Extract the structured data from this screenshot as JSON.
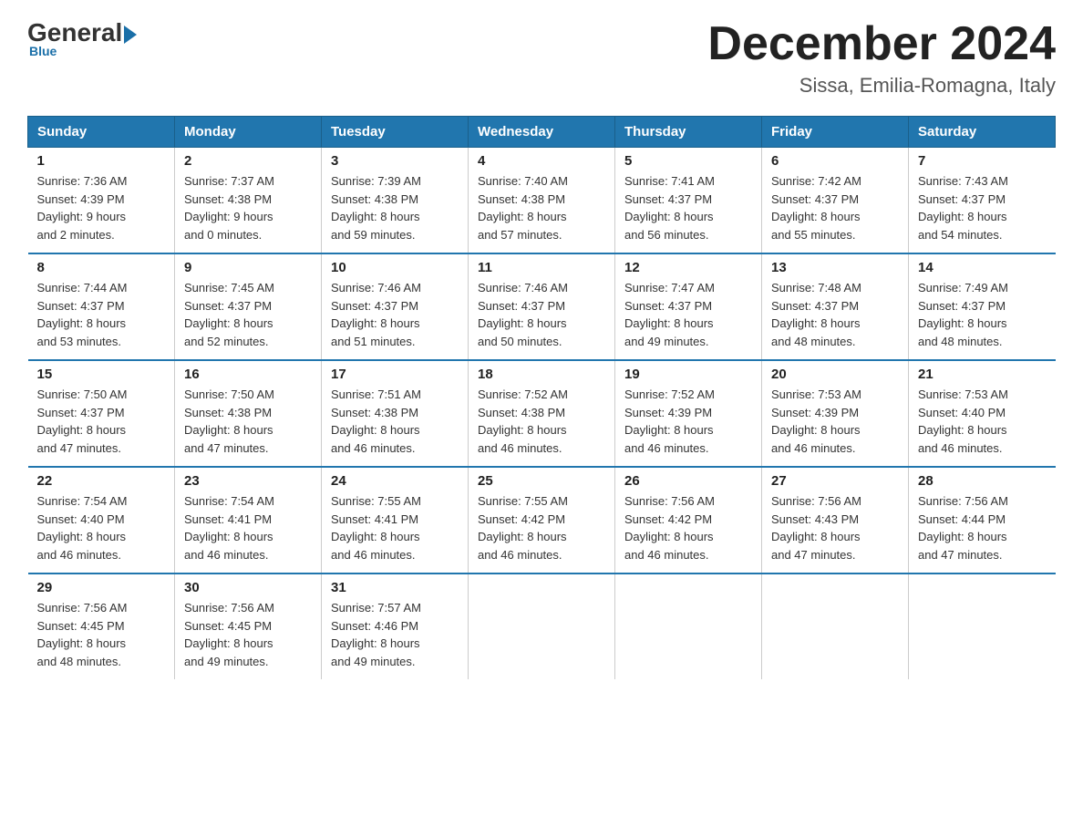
{
  "header": {
    "logo_general": "General",
    "logo_blue": "Blue",
    "month_title": "December 2024",
    "location": "Sissa, Emilia-Romagna, Italy"
  },
  "weekdays": [
    "Sunday",
    "Monday",
    "Tuesday",
    "Wednesday",
    "Thursday",
    "Friday",
    "Saturday"
  ],
  "weeks": [
    [
      {
        "day": "1",
        "sunrise": "7:36 AM",
        "sunset": "4:39 PM",
        "daylight": "9 hours and 2 minutes."
      },
      {
        "day": "2",
        "sunrise": "7:37 AM",
        "sunset": "4:38 PM",
        "daylight": "9 hours and 0 minutes."
      },
      {
        "day": "3",
        "sunrise": "7:39 AM",
        "sunset": "4:38 PM",
        "daylight": "8 hours and 59 minutes."
      },
      {
        "day": "4",
        "sunrise": "7:40 AM",
        "sunset": "4:38 PM",
        "daylight": "8 hours and 57 minutes."
      },
      {
        "day": "5",
        "sunrise": "7:41 AM",
        "sunset": "4:37 PM",
        "daylight": "8 hours and 56 minutes."
      },
      {
        "day": "6",
        "sunrise": "7:42 AM",
        "sunset": "4:37 PM",
        "daylight": "8 hours and 55 minutes."
      },
      {
        "day": "7",
        "sunrise": "7:43 AM",
        "sunset": "4:37 PM",
        "daylight": "8 hours and 54 minutes."
      }
    ],
    [
      {
        "day": "8",
        "sunrise": "7:44 AM",
        "sunset": "4:37 PM",
        "daylight": "8 hours and 53 minutes."
      },
      {
        "day": "9",
        "sunrise": "7:45 AM",
        "sunset": "4:37 PM",
        "daylight": "8 hours and 52 minutes."
      },
      {
        "day": "10",
        "sunrise": "7:46 AM",
        "sunset": "4:37 PM",
        "daylight": "8 hours and 51 minutes."
      },
      {
        "day": "11",
        "sunrise": "7:46 AM",
        "sunset": "4:37 PM",
        "daylight": "8 hours and 50 minutes."
      },
      {
        "day": "12",
        "sunrise": "7:47 AM",
        "sunset": "4:37 PM",
        "daylight": "8 hours and 49 minutes."
      },
      {
        "day": "13",
        "sunrise": "7:48 AM",
        "sunset": "4:37 PM",
        "daylight": "8 hours and 48 minutes."
      },
      {
        "day": "14",
        "sunrise": "7:49 AM",
        "sunset": "4:37 PM",
        "daylight": "8 hours and 48 minutes."
      }
    ],
    [
      {
        "day": "15",
        "sunrise": "7:50 AM",
        "sunset": "4:37 PM",
        "daylight": "8 hours and 47 minutes."
      },
      {
        "day": "16",
        "sunrise": "7:50 AM",
        "sunset": "4:38 PM",
        "daylight": "8 hours and 47 minutes."
      },
      {
        "day": "17",
        "sunrise": "7:51 AM",
        "sunset": "4:38 PM",
        "daylight": "8 hours and 46 minutes."
      },
      {
        "day": "18",
        "sunrise": "7:52 AM",
        "sunset": "4:38 PM",
        "daylight": "8 hours and 46 minutes."
      },
      {
        "day": "19",
        "sunrise": "7:52 AM",
        "sunset": "4:39 PM",
        "daylight": "8 hours and 46 minutes."
      },
      {
        "day": "20",
        "sunrise": "7:53 AM",
        "sunset": "4:39 PM",
        "daylight": "8 hours and 46 minutes."
      },
      {
        "day": "21",
        "sunrise": "7:53 AM",
        "sunset": "4:40 PM",
        "daylight": "8 hours and 46 minutes."
      }
    ],
    [
      {
        "day": "22",
        "sunrise": "7:54 AM",
        "sunset": "4:40 PM",
        "daylight": "8 hours and 46 minutes."
      },
      {
        "day": "23",
        "sunrise": "7:54 AM",
        "sunset": "4:41 PM",
        "daylight": "8 hours and 46 minutes."
      },
      {
        "day": "24",
        "sunrise": "7:55 AM",
        "sunset": "4:41 PM",
        "daylight": "8 hours and 46 minutes."
      },
      {
        "day": "25",
        "sunrise": "7:55 AM",
        "sunset": "4:42 PM",
        "daylight": "8 hours and 46 minutes."
      },
      {
        "day": "26",
        "sunrise": "7:56 AM",
        "sunset": "4:42 PM",
        "daylight": "8 hours and 46 minutes."
      },
      {
        "day": "27",
        "sunrise": "7:56 AM",
        "sunset": "4:43 PM",
        "daylight": "8 hours and 47 minutes."
      },
      {
        "day": "28",
        "sunrise": "7:56 AM",
        "sunset": "4:44 PM",
        "daylight": "8 hours and 47 minutes."
      }
    ],
    [
      {
        "day": "29",
        "sunrise": "7:56 AM",
        "sunset": "4:45 PM",
        "daylight": "8 hours and 48 minutes."
      },
      {
        "day": "30",
        "sunrise": "7:56 AM",
        "sunset": "4:45 PM",
        "daylight": "8 hours and 49 minutes."
      },
      {
        "day": "31",
        "sunrise": "7:57 AM",
        "sunset": "4:46 PM",
        "daylight": "8 hours and 49 minutes."
      },
      null,
      null,
      null,
      null
    ]
  ],
  "labels": {
    "sunrise": "Sunrise:",
    "sunset": "Sunset:",
    "daylight": "Daylight:"
  }
}
